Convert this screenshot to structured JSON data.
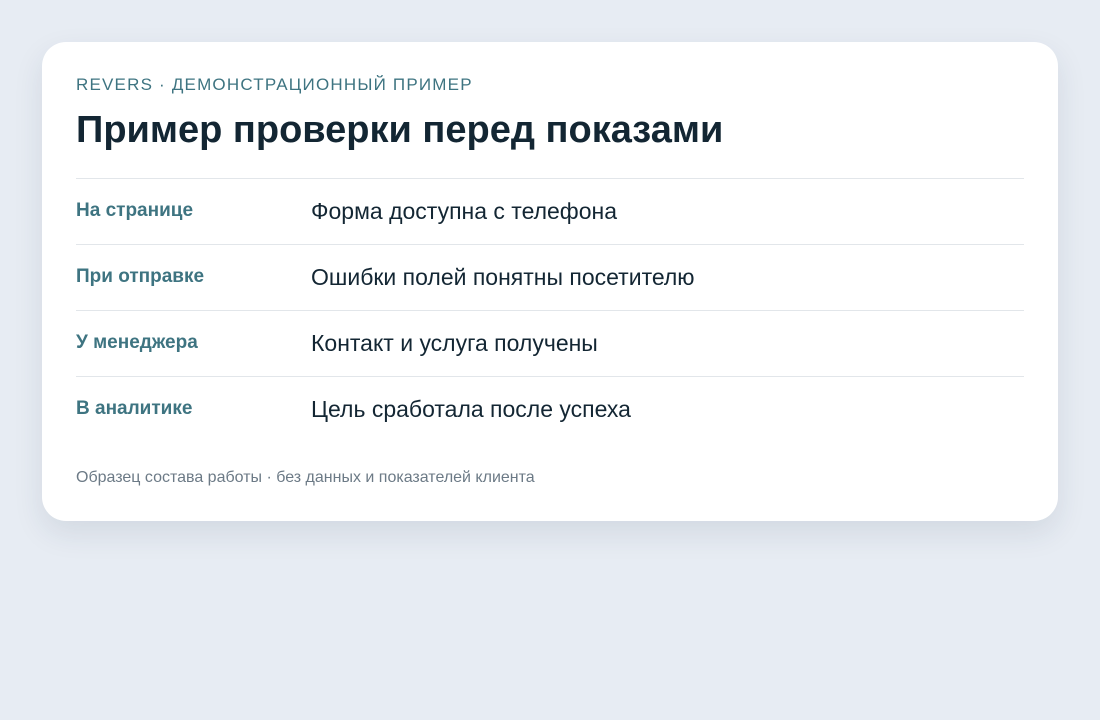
{
  "card": {
    "eyebrow": "REVERS · ДЕМОНСТРАЦИОННЫЙ ПРИМЕР",
    "title": "Пример проверки перед показами",
    "rows": [
      {
        "label": "На странице",
        "value": "Форма доступна с телефона"
      },
      {
        "label": "При отправке",
        "value": "Ошибки полей понятны посетителю"
      },
      {
        "label": "У менеджера",
        "value": "Контакт и услуга получены"
      },
      {
        "label": "В аналитике",
        "value": "Цель сработала после успеха"
      }
    ],
    "footnote": "Образец состава работы · без данных и показателей клиента"
  },
  "colors": {
    "background": "#e7ecf3",
    "card": "#ffffff",
    "accent": "#3e7481",
    "text": "#132633",
    "muted": "#6c7a86",
    "divider": "#e2e6ea"
  }
}
